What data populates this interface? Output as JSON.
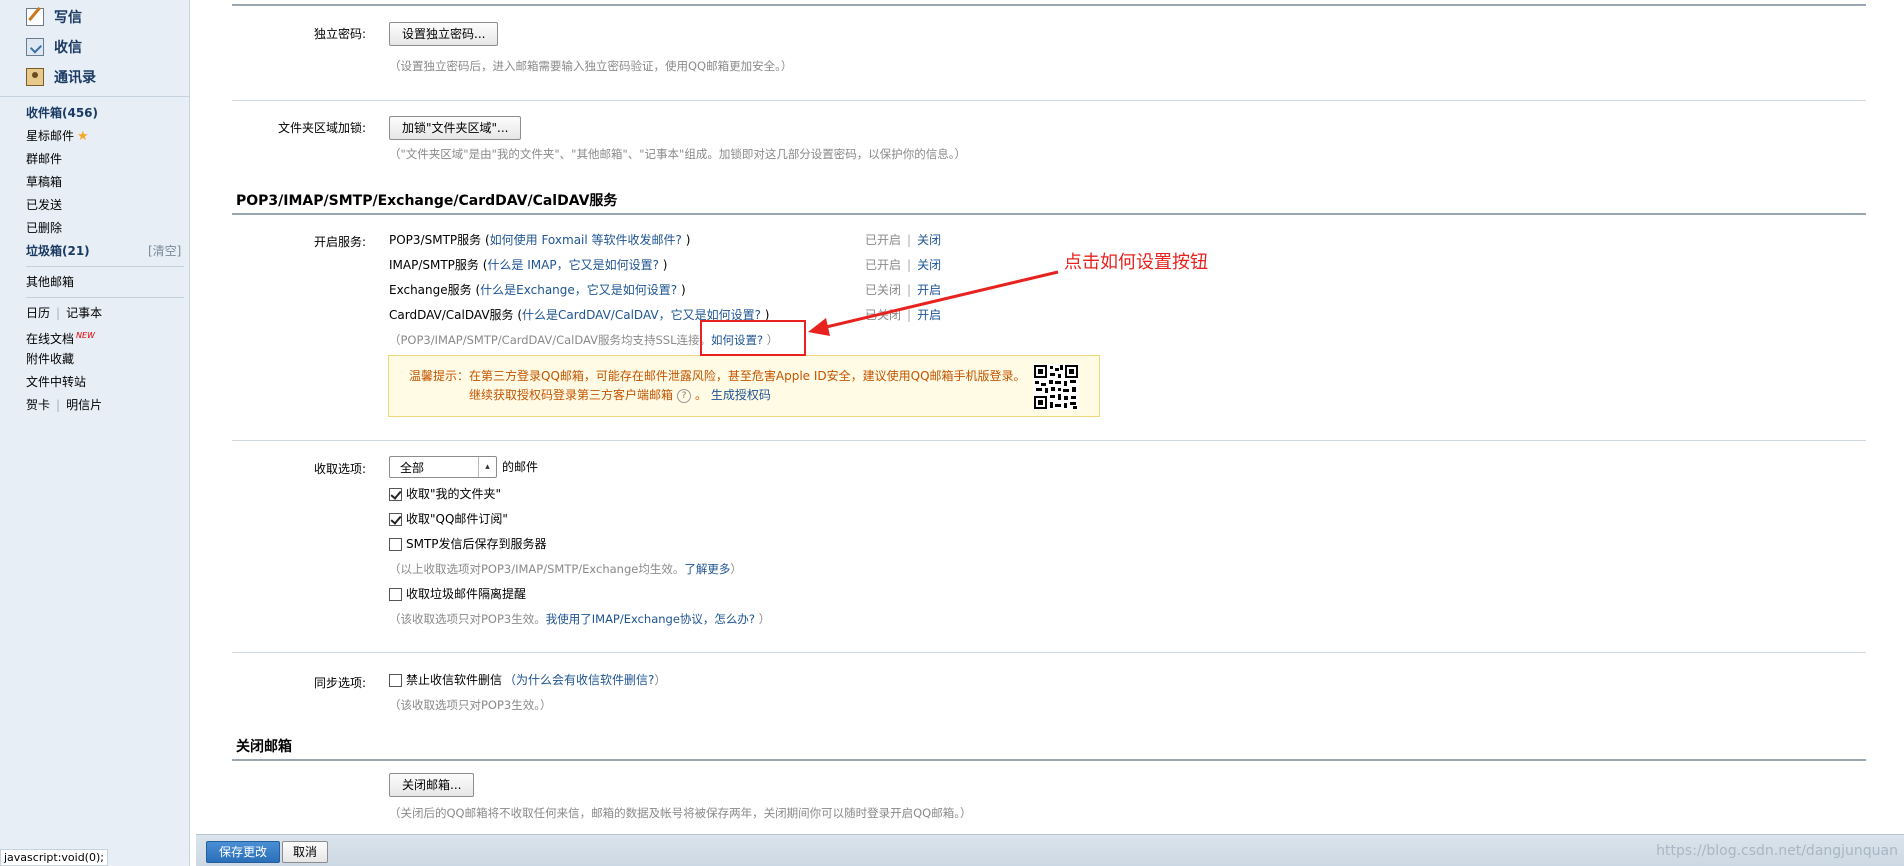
{
  "sidebar": {
    "write_label": "写信",
    "inbox_label": "收信",
    "contacts_label": "通讯录",
    "folders": {
      "inbox": "收件箱(456)",
      "starred": "星标邮件",
      "group": "群邮件",
      "drafts": "草稿箱",
      "sent": "已发送",
      "deleted": "已删除",
      "junk": "垃圾箱(21)",
      "junk_clear": "[清空]",
      "other": "其他邮箱"
    },
    "apps": {
      "calendar": "日历",
      "notes": "记事本",
      "online_docs": "在线文档",
      "new_badge": "NEW",
      "attachments": "附件收藏",
      "file_transfer": "文件中转站",
      "cards": "贺卡",
      "postcards": "明信片"
    }
  },
  "status_bar": "javascript:void(0);",
  "security": {
    "password_label": "独立密码:",
    "password_button": "设置独立密码...",
    "password_hint": "（设置独立密码后，进入邮箱需要输入独立密码验证，使用QQ邮箱更加安全。）",
    "folder_lock_label": "文件夹区域加锁:",
    "folder_lock_button": "加锁\"文件夹区域\"...",
    "folder_lock_hint": "（\"文件夹区域\"是由\"我的文件夹\"、\"其他邮箱\"、\"记事本\"组成。加锁即对这几部分设置密码，以保护你的信息。）"
  },
  "services": {
    "section_title": "POP3/IMAP/SMTP/Exchange/CardDAV/CalDAV服务",
    "enable_label": "开启服务:",
    "rows": [
      {
        "name": "POP3/SMTP服务 (",
        "link": "如何使用 Foxmail 等软件收发邮件?",
        "close": " )",
        "state": "已开启",
        "action": "关闭"
      },
      {
        "name": "IMAP/SMTP服务 (",
        "link": "什么是 IMAP，它又是如何设置?",
        "close": " )",
        "state": "已开启",
        "action": "关闭"
      },
      {
        "name": "Exchange服务 (",
        "link": "什么是Exchange，它又是如何设置?",
        "close": " )",
        "state": "已关闭",
        "action": "开启"
      },
      {
        "name": "CardDAV/CalDAV服务 (",
        "link": "什么是CardDAV/CalDAV，它又是如何设置?",
        "close": " )",
        "state": "已关闭",
        "action": "开启"
      }
    ],
    "ssl_hint": "（POP3/IMAP/SMTP/CardDAV/CalDAV服务均支持SSL连接。",
    "ssl_link": "如何设置?",
    "ssl_close": " ）",
    "tip_prefix": "温馨提示：在第三方登录QQ邮箱，可能存在邮件泄露风险，甚至危害Apple ID安全，建议使用QQ邮箱手机版登录。",
    "tip_line2": "继续获取授权码登录第三方客户端邮箱",
    "tip_help": "?",
    "tip_link": "生成授权码"
  },
  "receive": {
    "label": "收取选项:",
    "select_value": "全部",
    "select_suffix": "的邮件",
    "opt_my_folders": "收取\"我的文件夹\"",
    "opt_subscriptions": "收取\"QQ邮件订阅\"",
    "opt_smtp_save": "SMTP发信后保存到服务器",
    "hint1": "（以上收取选项对POP3/IMAP/SMTP/Exchange均生效。",
    "hint1_link": "了解更多",
    "hint1_close": "）",
    "opt_junk_reminder": "收取垃圾邮件隔离提醒",
    "hint2": "（该收取选项只对POP3生效。",
    "hint2_link": "我使用了IMAP/Exchange协议，怎么办?",
    "hint2_close": " ）"
  },
  "sync": {
    "label": "同步选项:",
    "opt_no_delete": "禁止收信软件删信",
    "opt_link": "（为什么会有收信软件删信?",
    "opt_close": " ）",
    "hint": "（该收取选项只对POP3生效。）"
  },
  "close_mailbox": {
    "title": "关闭邮箱",
    "button": "关闭邮箱...",
    "hint": "（关闭后的QQ邮箱将不收取任何来信，邮箱的数据及帐号将被保存两年，关闭期间你可以随时登录开启QQ邮箱。）"
  },
  "bottom": {
    "save_button": "保存更改",
    "cancel_button": "取消",
    "watermark": "https://blog.csdn.net/dangjunquan"
  },
  "annotation": {
    "text": "点击如何设置按钮",
    "color": "#e8231f"
  }
}
